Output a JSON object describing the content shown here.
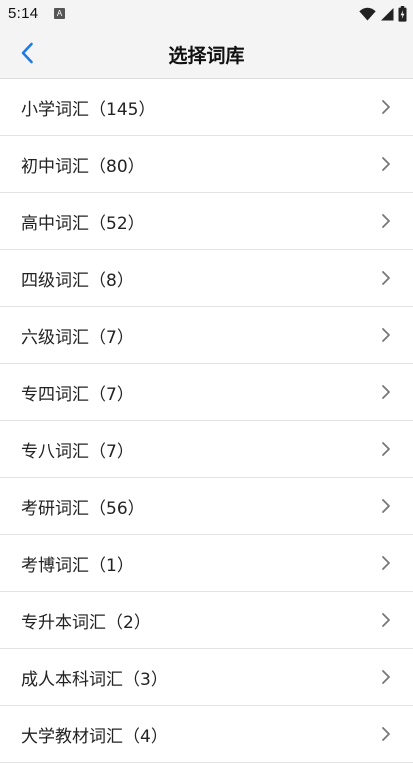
{
  "status_bar": {
    "time": "5:14",
    "notification_letter": "A",
    "icons": [
      "wifi-icon",
      "signal-icon",
      "battery-icon"
    ]
  },
  "header": {
    "title": "选择词库",
    "back_icon": "chevron-left-icon"
  },
  "colors": {
    "accent": "#1e7ae6",
    "chevron": "#777777",
    "divider": "#e3e3e3",
    "header_bg": "#f4f4f4"
  },
  "list": {
    "items": [
      {
        "label": "小学词汇（145）"
      },
      {
        "label": "初中词汇（80）"
      },
      {
        "label": "高中词汇（52）"
      },
      {
        "label": "四级词汇（8）"
      },
      {
        "label": "六级词汇（7）"
      },
      {
        "label": "专四词汇（7）"
      },
      {
        "label": "专八词汇（7）"
      },
      {
        "label": "考研词汇（56）"
      },
      {
        "label": "考博词汇（1）"
      },
      {
        "label": "专升本词汇（2）"
      },
      {
        "label": "成人本科词汇（3）"
      },
      {
        "label": "大学教材词汇（4）"
      }
    ]
  }
}
